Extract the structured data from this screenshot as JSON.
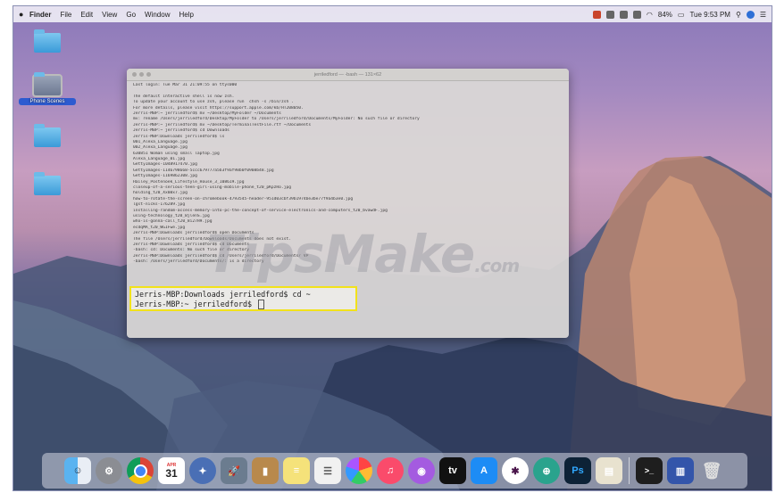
{
  "menubar": {
    "app_name": "Finder",
    "items": [
      "File",
      "Edit",
      "View",
      "Go",
      "Window",
      "Help"
    ],
    "battery": "84%",
    "clock": "Tue 9:53 PM"
  },
  "desktop_icons": [
    {
      "label": "",
      "selected": false
    },
    {
      "label": "Phone Scenes",
      "selected": true
    },
    {
      "label": "",
      "selected": false
    },
    {
      "label": "",
      "selected": false
    }
  ],
  "terminal": {
    "title": "jerriledford — -bash — 131×62",
    "lines": [
      "Last login: Tue Mar 31 21:09:55 on ttys000",
      "",
      "The default interactive shell is now zsh.",
      "To update your account to use zsh, please run `chsh -s /bin/zsh`.",
      "For more details, please visit https://support.apple.com/kb/HT208050.",
      "Jerris-MBP:~ jerriledford$ mv ~/Desktop/MyFolder ~/Documents",
      "mv: rename /Users/jerriledford/Desktop/MyFolder to /Users/jerriledford/Documents/MyFolder: No such file or directory",
      "Jerris-MBP:~ jerriledford$ mv ~/Desktop/TerminalTestFile.rtf ~/Documents",
      "Jerris-MBP:~ jerriledford$ cd Downloads",
      "Jerris-MBP:Downloads jerriledford$ ls",
      "001_Alexa_Language.jpg",
      "002_Alexa_Language.jpg",
      "630851 Woman using small laptop.jpg",
      "Alexa_Language_01.jpg",
      "GettyImages-1048917470.jpg",
      "GettyImages-1146798668-5ccc679777a5b3f9af98b0f0908b48.jpg",
      "GettyImages-1169862308.jpg",
      "Hailey_Postenoek_Lifestyle_House_3_108619.jpg",
      "closeup-of-a-serious-teen-girl-using-mobile-phone_t20_pKpzRo.jpg",
      "holding_t20_Xx0Bx7.jpg",
      "how-to-rotate-the-screen-on-chromebook-4793545-header-951d03cbf39b1974be3be77f9a4b3e0.jpg",
      "lgst-nicks-176289.jpg",
      "installing-random-access-memory-into-pc-the-concept-of-service-electronics-and-computers_t20_bvawdF.jpg",
      "using-technology_t20_BjlenS.jpg",
      "who-is-gonna-call_t20_8i27H9.jpg",
      "ecdqMA_t20_WGIFwe.jpg",
      "Jerris-MBP:Downloads jerriledford$ open Documents",
      "The file /Users/jerriledford/Downloads/Documents does not exist.",
      "Jerris-MBP:Downloads jerriledford$ cd Documents",
      "-bash: cd: Documents: No such file or directory",
      "Jerris-MBP:Downloads jerriledford$ cd /Users/jerriledford/Documents/ VP",
      "-bash: /Users/jerriledford/Documents/: is a directory"
    ],
    "highlight_line1": "Jerris-MBP:Downloads jerriledford$ cd ~",
    "highlight_line2": "Jerris-MBP:~ jerriledford$ "
  },
  "watermark": {
    "main": "TipsMake",
    "suffix": ".com"
  },
  "dock": {
    "calendar_month": "APR",
    "calendar_day": "31",
    "photoshop_label": "Ps",
    "tv_label": "tv"
  }
}
